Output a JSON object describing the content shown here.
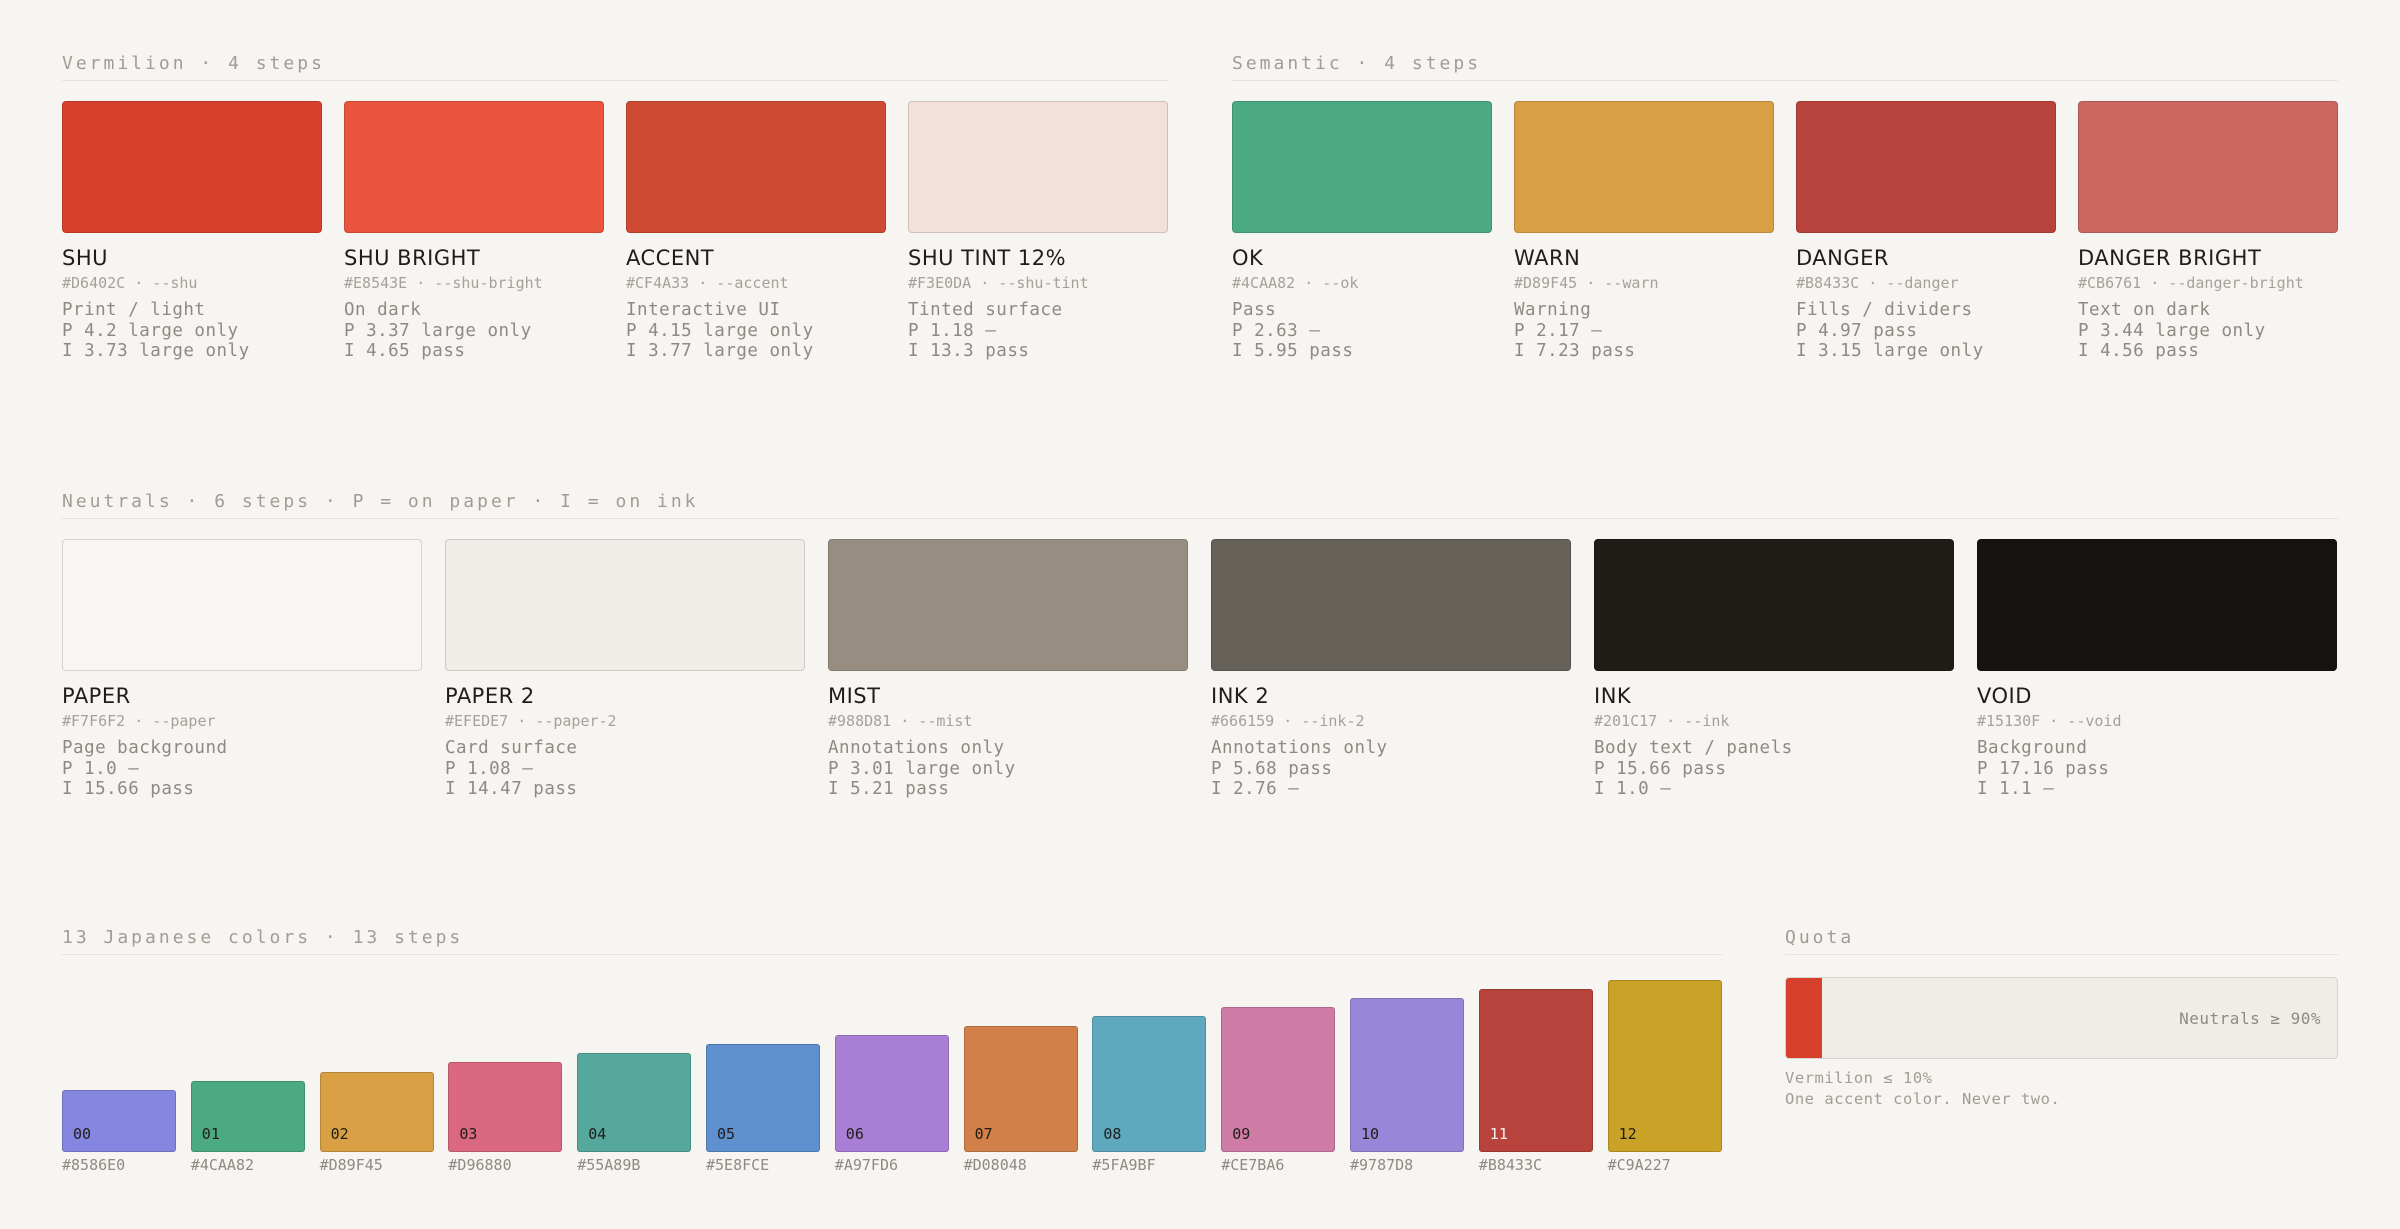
{
  "sections": {
    "vermilion": {
      "title": "Vermilion · 4 steps",
      "items": [
        {
          "name": "SHU",
          "hex": "#D6402C",
          "token": "--shu",
          "meta": "#D6402C · --shu",
          "use": "Print / light",
          "p": "P 4.2 large only",
          "i": "I 3.73 large only"
        },
        {
          "name": "SHU BRIGHT",
          "hex": "#E8543E",
          "token": "--shu-bright",
          "meta": "#E8543E · --shu-bright",
          "use": "On dark",
          "p": "P 3.37 large only",
          "i": "I 4.65 pass"
        },
        {
          "name": "ACCENT",
          "hex": "#CF4A33",
          "token": "--accent",
          "meta": "#CF4A33 · --accent",
          "use": "Interactive UI",
          "p": "P 4.15 large only",
          "i": "I 3.77 large only"
        },
        {
          "name": "SHU TINT 12%",
          "hex": "#F3E0DA",
          "token": "--shu-tint",
          "meta": "#F3E0DA · --shu-tint",
          "use": "Tinted surface",
          "p": "P 1.18 —",
          "i": "I 13.3 pass"
        }
      ]
    },
    "semantic": {
      "title": "Semantic · 4 steps",
      "items": [
        {
          "name": "OK",
          "hex": "#4CAA82",
          "token": "--ok",
          "meta": "#4CAA82 · --ok",
          "use": "Pass",
          "p": "P 2.63 —",
          "i": "I 5.95 pass"
        },
        {
          "name": "WARN",
          "hex": "#D89F45",
          "token": "--warn",
          "meta": "#D89F45 · --warn",
          "use": "Warning",
          "p": "P 2.17 —",
          "i": "I 7.23 pass"
        },
        {
          "name": "DANGER",
          "hex": "#B8433C",
          "token": "--danger",
          "meta": "#B8433C · --danger",
          "use": "Fills / dividers",
          "p": "P 4.97 pass",
          "i": "I 3.15 large only"
        },
        {
          "name": "DANGER BRIGHT",
          "hex": "#CB6761",
          "token": "--danger-bright",
          "meta": "#CB6761 · --danger-bright",
          "use": "Text on dark",
          "p": "P 3.44 large only",
          "i": "I 4.56 pass"
        }
      ]
    },
    "neutrals": {
      "title": "Neutrals · 6 steps · P = on paper · I = on ink",
      "items": [
        {
          "name": "PAPER",
          "hex": "#F7F6F2",
          "token": "--paper",
          "meta": "#F7F6F2 · --paper",
          "use": "Page background",
          "p": "P 1.0 —",
          "i": "I 15.66 pass"
        },
        {
          "name": "PAPER 2",
          "hex": "#EFEDE7",
          "token": "--paper-2",
          "meta": "#EFEDE7 · --paper-2",
          "use": "Card surface",
          "p": "P 1.08 —",
          "i": "I 14.47 pass"
        },
        {
          "name": "MIST",
          "hex": "#988D81",
          "token": "--mist",
          "meta": "#988D81 · --mist",
          "use": "Annotations only",
          "p": "P 3.01 large only",
          "i": "I 5.21 pass"
        },
        {
          "name": "INK 2",
          "hex": "#666159",
          "token": "--ink-2",
          "meta": "#666159 · --ink-2",
          "use": "Annotations only",
          "p": "P 5.68 pass",
          "i": "I 2.76 —"
        },
        {
          "name": "INK",
          "hex": "#201C17",
          "token": "--ink",
          "meta": "#201C17 · --ink",
          "use": "Body text / panels",
          "p": "P 15.66 pass",
          "i": "I 1.0 —"
        },
        {
          "name": "VOID",
          "hex": "#15130F",
          "token": "--void",
          "meta": "#15130F · --void",
          "use": "Background",
          "p": "P 17.16 pass",
          "i": "I 1.1 —"
        }
      ]
    },
    "japanese": {
      "title": "13 Japanese colors · 13 steps",
      "items": [
        {
          "num": "00",
          "hex": "#8586E0",
          "level": 1
        },
        {
          "num": "01",
          "hex": "#4CAA82",
          "level": 2
        },
        {
          "num": "02",
          "hex": "#D89F45",
          "level": 3
        },
        {
          "num": "03",
          "hex": "#D96880",
          "level": 4
        },
        {
          "num": "04",
          "hex": "#55A89B",
          "level": 5
        },
        {
          "num": "05",
          "hex": "#5E8FCE",
          "level": 6
        },
        {
          "num": "06",
          "hex": "#A97FD6",
          "level": 7
        },
        {
          "num": "07",
          "hex": "#D08048",
          "level": 8
        },
        {
          "num": "08",
          "hex": "#5FA9BF",
          "level": 9
        },
        {
          "num": "09",
          "hex": "#CE7BA6",
          "level": 10
        },
        {
          "num": "10",
          "hex": "#9787D8",
          "level": 11
        },
        {
          "num": "11",
          "hex": "#B8433C",
          "level": 12
        },
        {
          "num": "12",
          "hex": "#C9A227",
          "level": 13
        }
      ]
    },
    "quota": {
      "title": "Quota",
      "bar_label": "Neutrals ≥ 90%",
      "fill_fraction": 0.065,
      "fill_color": "#D6402C",
      "note1": "Vermilion ≤ 10%",
      "note2": "One accent color. Never two."
    }
  }
}
